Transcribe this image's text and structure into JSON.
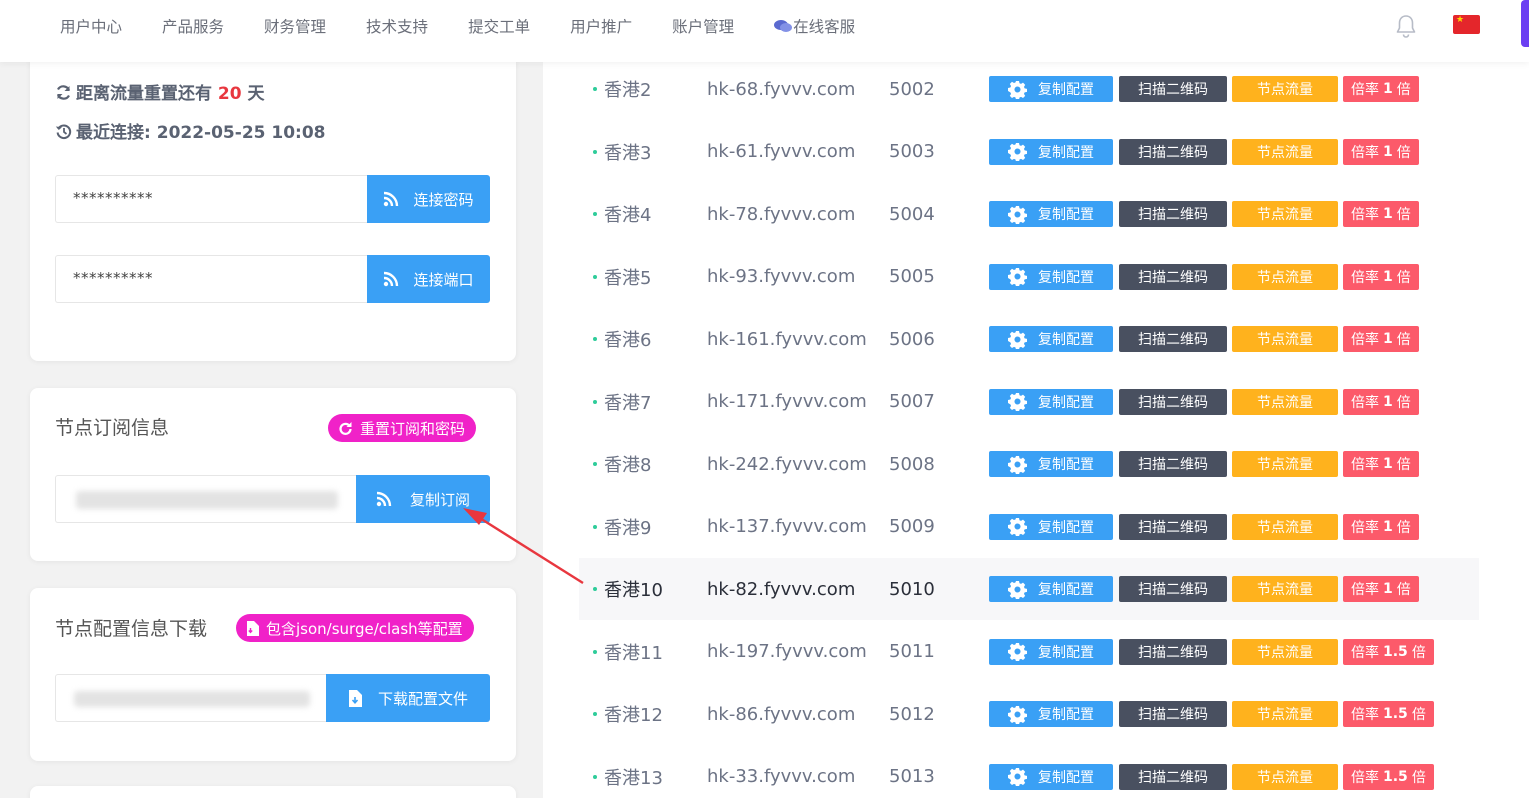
{
  "nav": {
    "items": [
      "用户中心",
      "产品服务",
      "财务管理",
      "技术支持",
      "提交工单",
      "用户推广",
      "账户管理"
    ],
    "support": "在线客服"
  },
  "account": {
    "reset_prefix": "距离流量重置还有",
    "reset_days": "20",
    "reset_suffix": "天",
    "last_conn_label": "最近连接:",
    "last_conn_time": "2022-05-25 10:08",
    "password_value": "**********",
    "password_btn": "连接密码",
    "port_value": "**********",
    "port_btn": "连接端口"
  },
  "subscribe": {
    "title": "节点订阅信息",
    "reset_btn": "重置订阅和密码",
    "copy_btn": "复制订阅"
  },
  "config": {
    "title": "节点配置信息下载",
    "formats_btn": "包含json/surge/clash等配置",
    "download_btn": "下载配置文件"
  },
  "node_buttons": {
    "copy": "复制配置",
    "qr": "扫描二维码",
    "traffic": "节点流量",
    "rate_label": "倍率",
    "rate_unit": "倍"
  },
  "nodes": [
    {
      "name": "香港2",
      "host": "hk-68.fyvvv.com",
      "port": "5002",
      "rate": "1"
    },
    {
      "name": "香港3",
      "host": "hk-61.fyvvv.com",
      "port": "5003",
      "rate": "1"
    },
    {
      "name": "香港4",
      "host": "hk-78.fyvvv.com",
      "port": "5004",
      "rate": "1"
    },
    {
      "name": "香港5",
      "host": "hk-93.fyvvv.com",
      "port": "5005",
      "rate": "1"
    },
    {
      "name": "香港6",
      "host": "hk-161.fyvvv.com",
      "port": "5006",
      "rate": "1"
    },
    {
      "name": "香港7",
      "host": "hk-171.fyvvv.com",
      "port": "5007",
      "rate": "1"
    },
    {
      "name": "香港8",
      "host": "hk-242.fyvvv.com",
      "port": "5008",
      "rate": "1"
    },
    {
      "name": "香港9",
      "host": "hk-137.fyvvv.com",
      "port": "5009",
      "rate": "1"
    },
    {
      "name": "香港10",
      "host": "hk-82.fyvvv.com",
      "port": "5010",
      "rate": "1",
      "highlighted": true
    },
    {
      "name": "香港11",
      "host": "hk-197.fyvvv.com",
      "port": "5011",
      "rate": "1.5"
    },
    {
      "name": "香港12",
      "host": "hk-86.fyvvv.com",
      "port": "5012",
      "rate": "1.5"
    },
    {
      "name": "香港13",
      "host": "hk-33.fyvvv.com",
      "port": "5013",
      "rate": "1.5"
    }
  ],
  "colors": {
    "primary": "#3aa0f5",
    "dark": "#495060",
    "warning": "#ffb21d",
    "danger": "#fc5a6a",
    "pill": "#f022c8",
    "highlight_days": "#e8373f",
    "flag": "#e4262b"
  }
}
